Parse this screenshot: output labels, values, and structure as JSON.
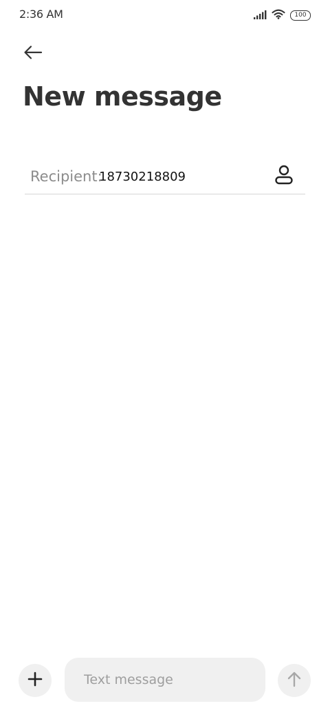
{
  "status_bar": {
    "time": "2:36 AM",
    "battery_level": "100",
    "icons": [
      "signal-icon",
      "wifi-icon",
      "battery-icon"
    ]
  },
  "header": {
    "back_icon": "arrow-left-icon",
    "title": "New message"
  },
  "recipient": {
    "label": "Recipient:",
    "value": "18730218809",
    "contact_icon": "person-icon"
  },
  "composer": {
    "attach_icon": "plus-icon",
    "placeholder": "Text message",
    "send_icon": "arrow-up-icon"
  },
  "colors": {
    "background": "#ffffff",
    "text": "#333333",
    "label": "#8c8c8c",
    "field_bg": "#f0f0f0",
    "divider": "#d6d6d6"
  }
}
